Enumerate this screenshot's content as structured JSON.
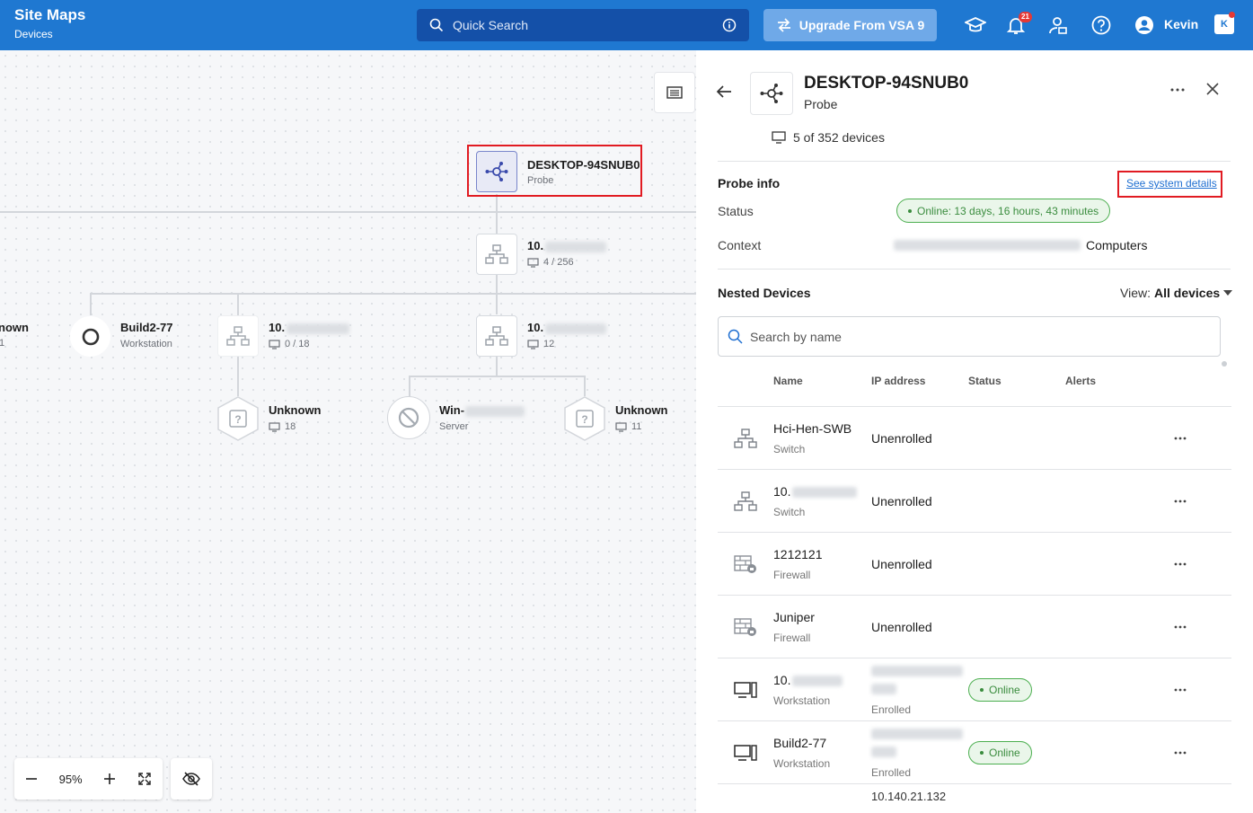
{
  "header": {
    "title": "Site Maps",
    "subtitle": "Devices",
    "search_placeholder": "Quick Search",
    "upgrade_label": "Upgrade From VSA 9",
    "notification_count": "21",
    "user_name": "Kevin",
    "app_badge": "K"
  },
  "map": {
    "probe_node": {
      "name": "DESKTOP-94SNUB0",
      "type": "Probe"
    },
    "switch_top": {
      "name": "10.",
      "count": "4 / 256"
    },
    "left_partial": {
      "name": "nown",
      "count": "1"
    },
    "build_node": {
      "name": "Build2-77",
      "type": "Workstation"
    },
    "switch_left": {
      "name": "10.",
      "count": "0 / 18"
    },
    "switch_mid": {
      "name": "10.",
      "count": "12"
    },
    "unknown_left": {
      "name": "Unknown",
      "count": "18"
    },
    "win_node": {
      "name": "Win-",
      "type": "Server"
    },
    "unknown_right": {
      "name": "Unknown",
      "count": "11"
    },
    "zoom_level": "95%"
  },
  "panel": {
    "title": "DESKTOP-94SNUB0",
    "subtitle": "Probe",
    "device_count": "5 of 352 devices",
    "probe_info_label": "Probe info",
    "see_system_details": "See system details",
    "status_label": "Status",
    "status_value": "Online: 13 days, 16 hours, 43 minutes",
    "context_label": "Context",
    "context_value": "Computers",
    "nested_label": "Nested Devices",
    "view_label": "View:",
    "view_value": "All devices",
    "search_placeholder": "Search by name",
    "columns": [
      "Name",
      "IP address",
      "Status",
      "Alerts"
    ],
    "rows": [
      {
        "name": "Hci-Hen-SWB",
        "type": "Switch",
        "ip": "Unenrolled",
        "ipsub": "",
        "status": "",
        "icon": "switch-icon"
      },
      {
        "name": "10.",
        "type": "Switch",
        "ip": "Unenrolled",
        "ipsub": "",
        "status": "",
        "icon": "switch-icon"
      },
      {
        "name": "1212121",
        "type": "Firewall",
        "ip": "Unenrolled",
        "ipsub": "",
        "status": "",
        "icon": "firewall-icon"
      },
      {
        "name": "Juniper",
        "type": "Firewall",
        "ip": "Unenrolled",
        "ipsub": "",
        "status": "",
        "icon": "firewall-icon"
      },
      {
        "name": "10.",
        "type": "Workstation",
        "ip": "",
        "ipsub": "Enrolled",
        "status": "Online",
        "icon": "workstation-icon"
      },
      {
        "name": "Build2-77",
        "type": "Workstation",
        "ip": "",
        "ipsub": "Enrolled",
        "status": "Online",
        "icon": "workstation-icon"
      }
    ],
    "partial_row_ip": "10.140.21.132"
  },
  "colors": {
    "header": "#1f78d1",
    "accent": "#1f6fd1",
    "online": "#4caf50",
    "highlight": "#e11b22"
  }
}
